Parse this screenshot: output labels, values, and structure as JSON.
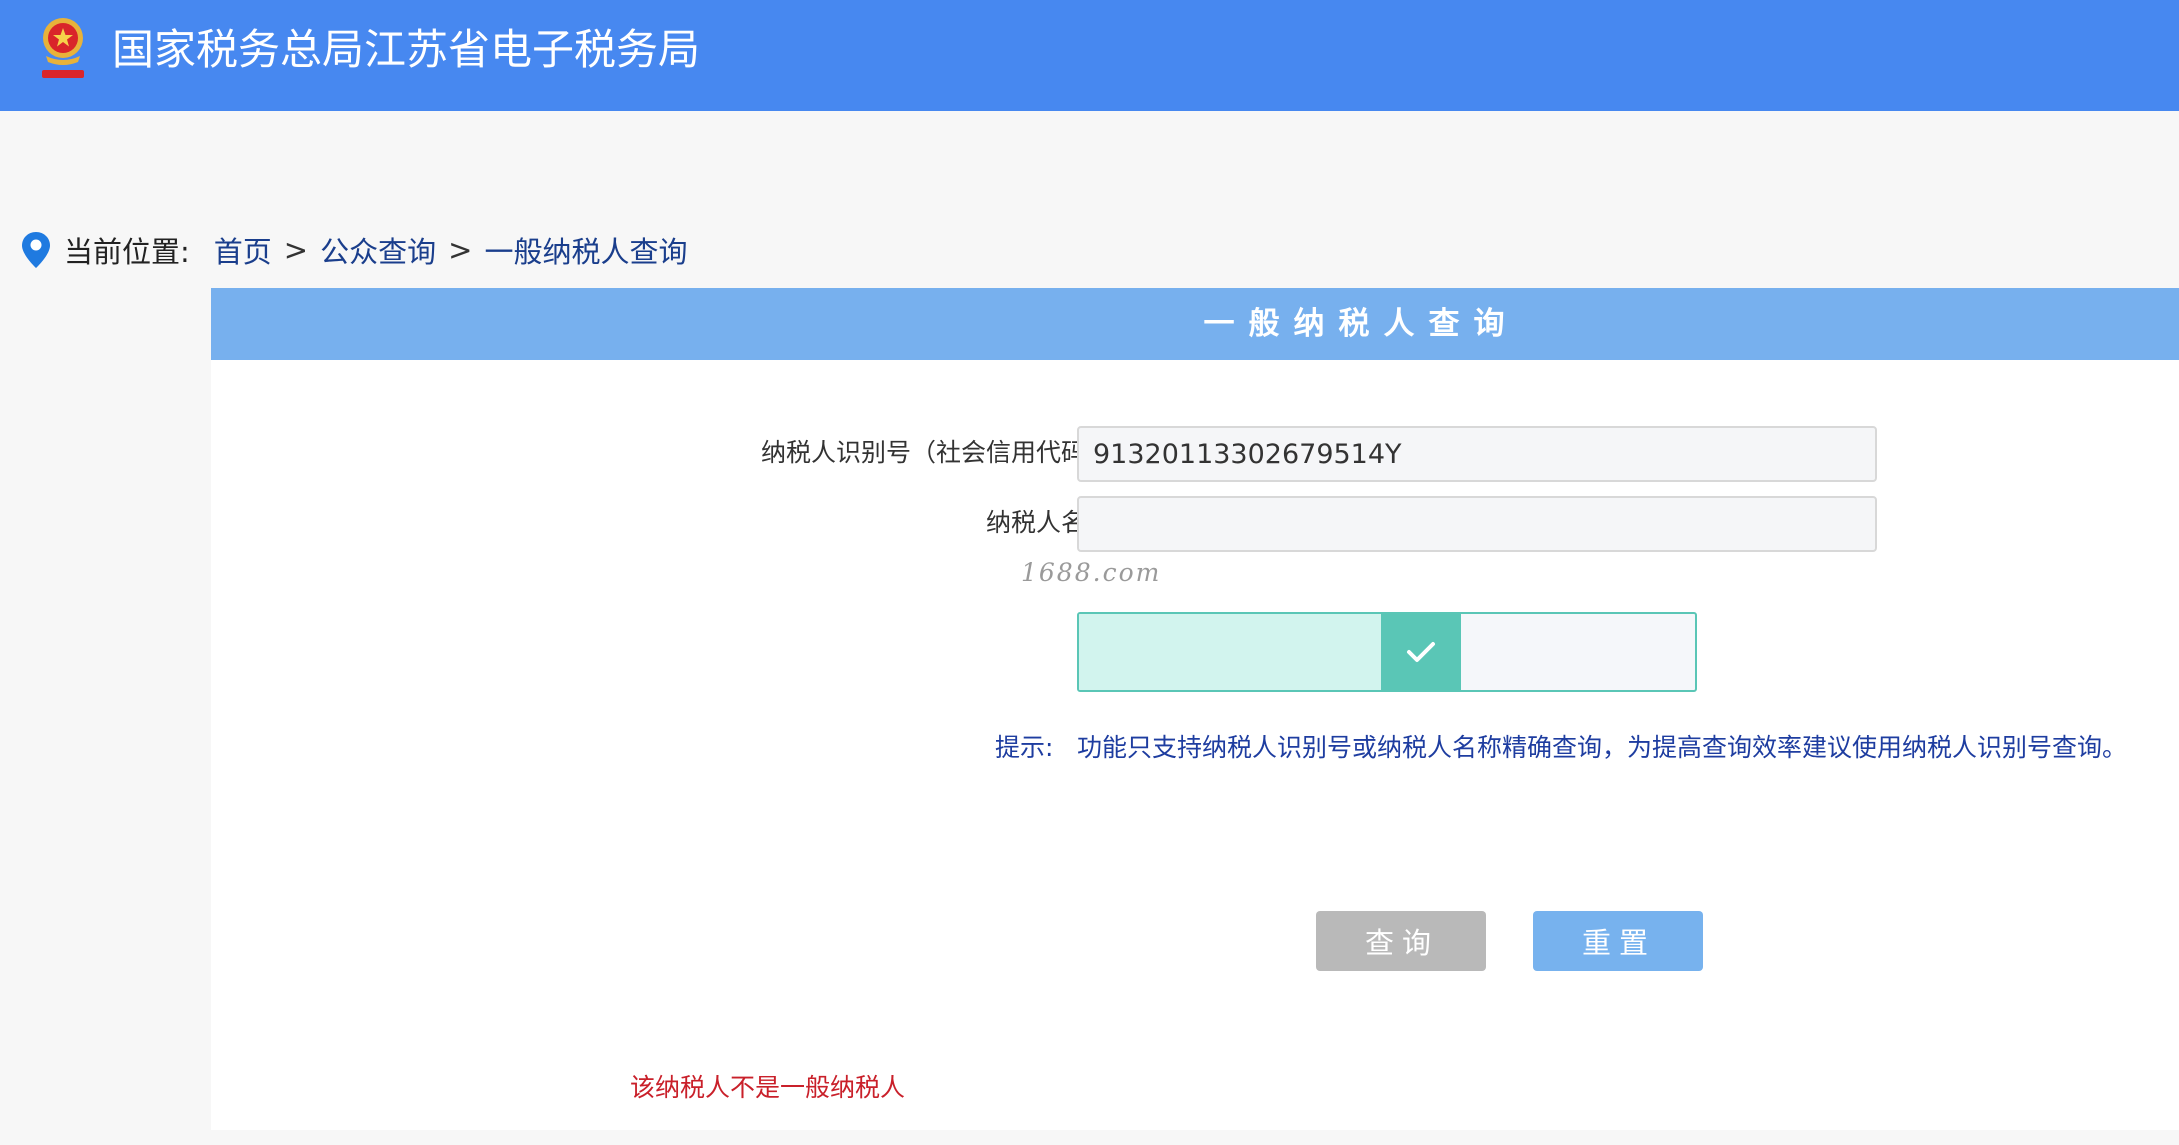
{
  "header": {
    "site_title": "国家税务总局江苏省电子税务局",
    "emblem_icon": "tax-emblem-icon",
    "background_color": "#4788f0"
  },
  "breadcrumb": {
    "label": "当前位置:",
    "items": [
      "首页",
      "公众查询",
      "一般纳税人查询"
    ],
    "separator": ">"
  },
  "panel": {
    "title": "一般纳税人查询",
    "header_color": "#77b0ee"
  },
  "form": {
    "taxpayer_id": {
      "label": "纳税人识别号（社会信用代码）",
      "value": "91320113302679514Y"
    },
    "taxpayer_name": {
      "label": "纳税人名称",
      "value": ""
    },
    "slider_verify": {
      "status": "verified",
      "progress": 0.62,
      "handle_icon": "checkmark-icon",
      "accent_color": "#5ac6b6"
    },
    "hint_label": "提示:",
    "hint_text": "功能只支持纳税人识别号或纳税人名称精确查询，为提高查询效率建议使用纳税人识别号查询。"
  },
  "watermark": "1688.com",
  "buttons": {
    "query_label": "查询",
    "reset_label": "重置"
  },
  "result": {
    "message": "该纳税人不是一般纳税人",
    "color": "#c9202a"
  }
}
